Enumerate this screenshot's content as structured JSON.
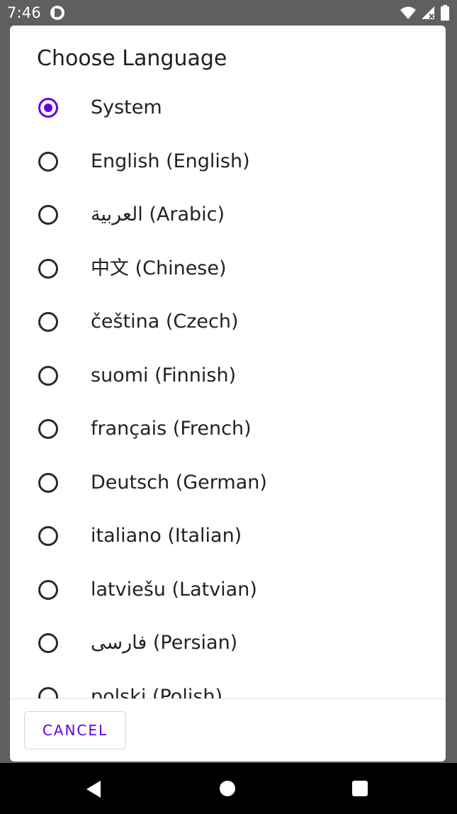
{
  "status_bar": {
    "time": "7:46",
    "icons": [
      "app-notification-icon",
      "wifi-icon",
      "cellular-signal-icon",
      "battery-icon"
    ]
  },
  "dialog": {
    "title": "Choose Language",
    "accent_color": "#6200ee",
    "selected_option": "System",
    "options": [
      {
        "label": "System",
        "checked": true
      },
      {
        "label": "English (English)",
        "checked": false
      },
      {
        "label": "العربية (Arabic)",
        "checked": false
      },
      {
        "label": "中文 (Chinese)",
        "checked": false
      },
      {
        "label": "čeština (Czech)",
        "checked": false
      },
      {
        "label": "suomi (Finnish)",
        "checked": false
      },
      {
        "label": "français (French)",
        "checked": false
      },
      {
        "label": "Deutsch (German)",
        "checked": false
      },
      {
        "label": "italiano (Italian)",
        "checked": false
      },
      {
        "label": "latviešu (Latvian)",
        "checked": false
      },
      {
        "label": "فارسی (Persian)",
        "checked": false
      },
      {
        "label": "polski (Polish)",
        "checked": false
      }
    ],
    "cancel_label": "CANCEL"
  },
  "nav_bar": {
    "icons": [
      "back-icon",
      "home-icon",
      "recents-icon"
    ]
  }
}
